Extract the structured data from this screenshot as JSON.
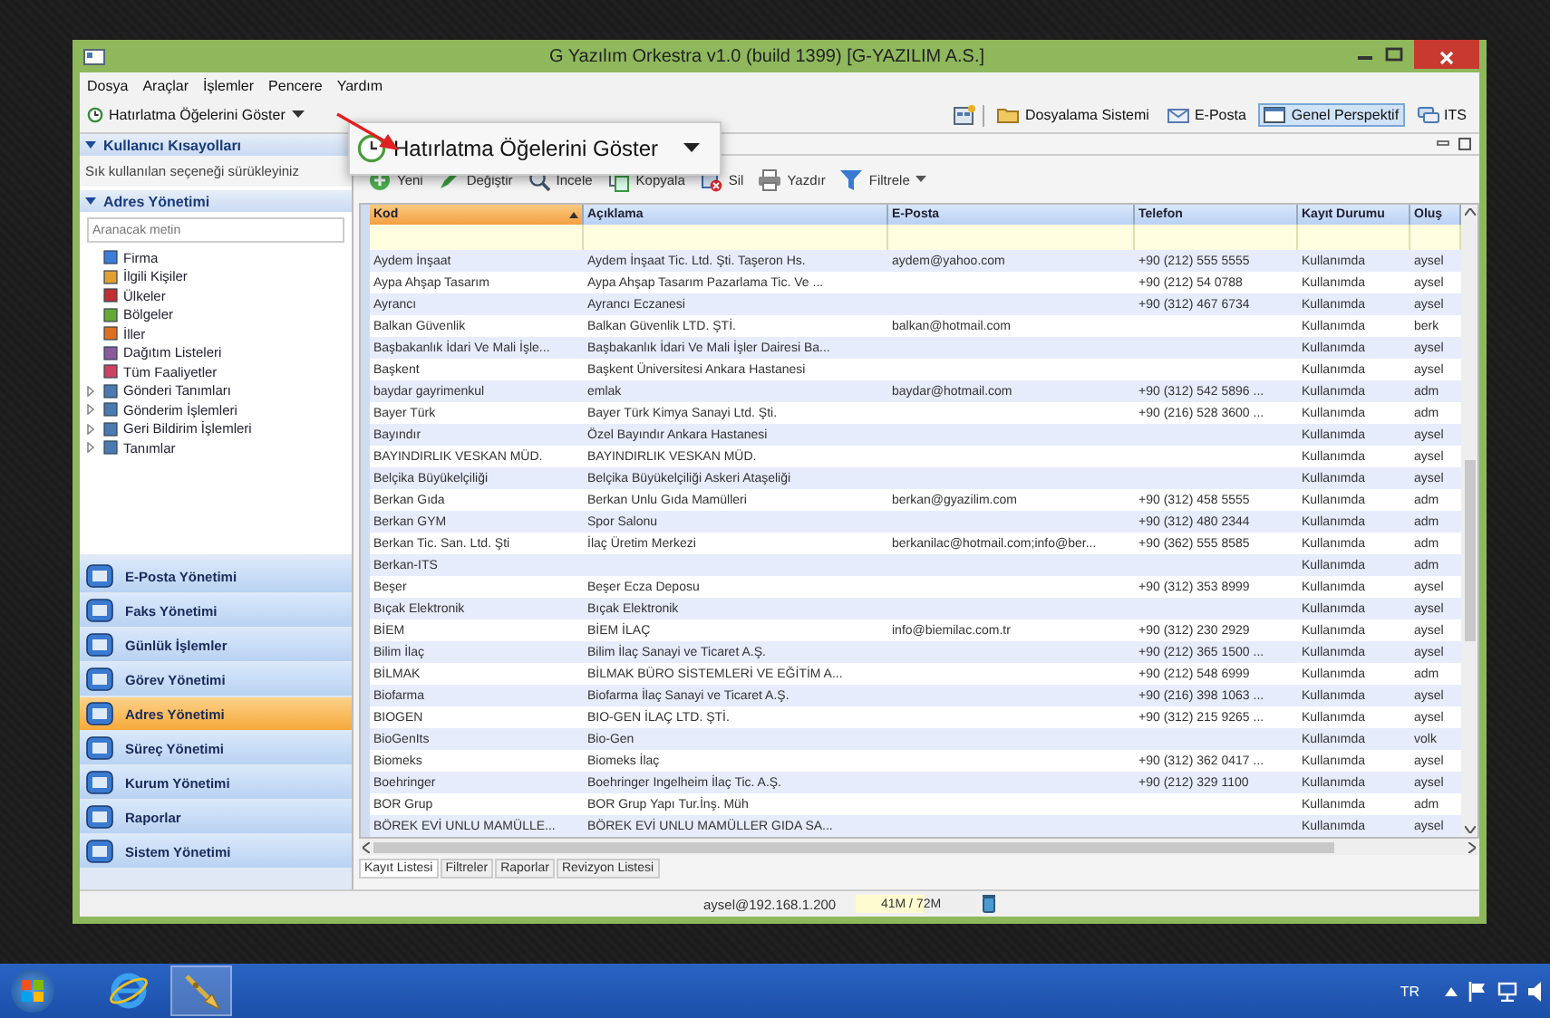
{
  "window": {
    "title": "G Yazılım Orkestra v1.0 (build 1399) [G-YAZILIM A.S.]"
  },
  "menu": [
    "Dosya",
    "Araçlar",
    "İşlemler",
    "Pencere",
    "Yardım"
  ],
  "reminder_button": {
    "label": "Hatırlatma Öğelerini Göster"
  },
  "callout": {
    "label": "Hatırlatma Öğelerini Göster"
  },
  "perspectives": [
    {
      "label": "Dosyalama Sistemi",
      "kind": "folder",
      "selected": false
    },
    {
      "label": "E-Posta",
      "kind": "mail",
      "selected": false
    },
    {
      "label": "Genel Perspektif",
      "kind": "window",
      "selected": true
    },
    {
      "label": "ITS",
      "kind": "chat",
      "selected": false
    }
  ],
  "sidebar": {
    "shortcuts_title": "Kullanıcı Kısayolları",
    "shortcuts_hint": "Sık kullanılan seçeneği sürükleyiniz",
    "section_title": "Adres Yönetimi",
    "search_placeholder": "Aranacak metin",
    "tree": [
      {
        "label": "Firma",
        "kind": "leaf"
      },
      {
        "label": "İlgili Kişiler",
        "kind": "leaf"
      },
      {
        "label": "Ülkeler",
        "kind": "leaf"
      },
      {
        "label": "Bölgeler",
        "kind": "leaf"
      },
      {
        "label": "İller",
        "kind": "leaf"
      },
      {
        "label": "Dağıtım Listeleri",
        "kind": "leaf"
      },
      {
        "label": "Tüm Faaliyetler",
        "kind": "leaf"
      },
      {
        "label": "Gönderi Tanımları",
        "kind": "folder"
      },
      {
        "label": "Gönderim İşlemleri",
        "kind": "folder"
      },
      {
        "label": "Geri Bildirim İşlemleri",
        "kind": "folder"
      },
      {
        "label": "Tanımlar",
        "kind": "folder"
      }
    ],
    "nav": [
      {
        "label": "E-Posta Yönetimi",
        "selected": false
      },
      {
        "label": "Faks Yönetimi",
        "selected": false
      },
      {
        "label": "Günlük İşlemler",
        "selected": false
      },
      {
        "label": "Görev Yönetimi",
        "selected": false
      },
      {
        "label": "Adres Yönetimi",
        "selected": true
      },
      {
        "label": "Süreç Yönetimi",
        "selected": false
      },
      {
        "label": "Kurum Yönetimi",
        "selected": false
      },
      {
        "label": "Raporlar",
        "selected": false
      },
      {
        "label": "Sistem Yönetimi",
        "selected": false
      }
    ]
  },
  "actions": [
    {
      "label": "Yeni",
      "kind": "new",
      "dropdown": false
    },
    {
      "label": "Değiştir",
      "kind": "edit",
      "dropdown": false
    },
    {
      "label": "İncele",
      "kind": "view",
      "dropdown": false
    },
    {
      "label": "Kopyala",
      "kind": "copy",
      "dropdown": false
    },
    {
      "label": "Sil",
      "kind": "delete",
      "dropdown": false
    },
    {
      "label": "Yazdır",
      "kind": "print",
      "dropdown": false
    },
    {
      "label": "Filtrele",
      "kind": "filter",
      "dropdown": true
    }
  ],
  "table": {
    "columns": [
      {
        "label": "Kod",
        "sorted": true
      },
      {
        "label": "Açıklama",
        "sorted": false
      },
      {
        "label": "E-Posta",
        "sorted": false
      },
      {
        "label": "Telefon",
        "sorted": false
      },
      {
        "label": "Kayıt Durumu",
        "sorted": false
      },
      {
        "label": "Oluş",
        "sorted": false
      }
    ],
    "rows": [
      [
        "Aydem İnşaat",
        "Aydem İnşaat Tic. Ltd. Şti. Taşeron Hs.",
        "aydem@yahoo.com",
        "+90 (212) 555 5555",
        "Kullanımda",
        "aysel"
      ],
      [
        "Aypa Ahşap Tasarım",
        "Aypa Ahşap Tasarım Pazarlama Tic. Ve ...",
        "",
        "+90 (212) 54 0788",
        "Kullanımda",
        "aysel"
      ],
      [
        "Ayrancı",
        "Ayrancı Eczanesi",
        "",
        "+90 (312) 467 6734",
        "Kullanımda",
        "aysel"
      ],
      [
        "Balkan Güvenlik",
        "Balkan Güvenlik LTD. ŞTİ.",
        "balkan@hotmail.com",
        "",
        "Kullanımda",
        "berk"
      ],
      [
        "Başbakanlık İdari Ve Mali İşle...",
        "Başbakanlık İdari Ve Mali İşler Dairesi Ba...",
        "",
        "",
        "Kullanımda",
        "aysel"
      ],
      [
        "Başkent",
        "Başkent Üniversitesi Ankara Hastanesi",
        "",
        "",
        "Kullanımda",
        "aysel"
      ],
      [
        "baydar gayrimenkul",
        "emlak",
        "baydar@hotmail.com",
        "+90 (312) 542 5896 ...",
        "Kullanımda",
        "adm"
      ],
      [
        "Bayer Türk",
        "Bayer Türk Kimya Sanayi Ltd. Şti.",
        "",
        "+90 (216) 528 3600 ...",
        "Kullanımda",
        "adm"
      ],
      [
        "Bayındır",
        "Özel Bayındır Ankara Hastanesi",
        "",
        "",
        "Kullanımda",
        "aysel"
      ],
      [
        "BAYINDIRLIK VESKAN MÜD.",
        "BAYINDIRLIK VESKAN MÜD.",
        "",
        "",
        "Kullanımda",
        "aysel"
      ],
      [
        "Belçika Büyükelçiliği",
        "Belçika Büyükelçiliği Askeri Ataşeliği",
        "",
        "",
        "Kullanımda",
        "aysel"
      ],
      [
        "Berkan Gıda",
        "Berkan Unlu Gıda Mamülleri",
        "berkan@gyazilim.com",
        "+90 (312) 458 5555",
        "Kullanımda",
        "adm"
      ],
      [
        "Berkan GYM",
        "Spor Salonu",
        "",
        "+90 (312) 480 2344",
        "Kullanımda",
        "adm"
      ],
      [
        "Berkan Tic. San. Ltd. Şti",
        "İlaç Üretim Merkezi",
        "berkanilac@hotmail.com;info@ber...",
        "+90 (362) 555 8585",
        "Kullanımda",
        "adm"
      ],
      [
        "Berkan-ITS",
        "",
        "",
        "",
        "Kullanımda",
        "adm"
      ],
      [
        "Beşer",
        "Beşer Ecza Deposu",
        "",
        "+90 (312) 353 8999",
        "Kullanımda",
        "aysel"
      ],
      [
        "Bıçak Elektronik",
        "Bıçak Elektronik",
        "",
        "",
        "Kullanımda",
        "aysel"
      ],
      [
        "BİEM",
        "BİEM İLAÇ",
        "info@biemilac.com.tr",
        "+90 (312) 230 2929",
        "Kullanımda",
        "aysel"
      ],
      [
        "Bilim İlaç",
        "Bilim İlaç Sanayi ve Ticaret A.Ş.",
        "",
        "+90 (212) 365 1500 ...",
        "Kullanımda",
        "aysel"
      ],
      [
        "BİLMAK",
        "BİLMAK BÜRO SİSTEMLERİ VE EĞİTİM A...",
        "",
        "+90 (212) 548 6999",
        "Kullanımda",
        "adm"
      ],
      [
        "Biofarma",
        "Biofarma İlaç Sanayi ve Ticaret A.Ş.",
        "",
        "+90 (216) 398 1063 ...",
        "Kullanımda",
        "aysel"
      ],
      [
        "BIOGEN",
        "BIO-GEN İLAÇ LTD. ŞTİ.",
        "",
        "+90 (312) 215 9265 ...",
        "Kullanımda",
        "aysel"
      ],
      [
        "BioGenIts",
        "Bio-Gen",
        "",
        "",
        "Kullanımda",
        "volk"
      ],
      [
        "Biomeks",
        "Biomeks İlaç",
        "",
        "+90 (312) 362 0417 ...",
        "Kullanımda",
        "aysel"
      ],
      [
        "Boehringer",
        "Boehringer Ingelheim İlaç Tic. A.Ş.",
        "",
        "+90 (212) 329 1100",
        "Kullanımda",
        "aysel"
      ],
      [
        "BOR Grup",
        "BOR Grup Yapı Tur.İnş. Müh",
        "",
        "",
        "Kullanımda",
        "adm"
      ],
      [
        "BÖREK EVİ UNLU MAMÜLLE...",
        "BÖREK EVİ UNLU MAMÜLLER GIDA SA...",
        "",
        "",
        "Kullanımda",
        "aysel"
      ]
    ]
  },
  "bottom_tabs": [
    {
      "label": "Kayıt Listesi",
      "selected": true
    },
    {
      "label": "Filtreler",
      "selected": false
    },
    {
      "label": "Raporlar",
      "selected": false
    },
    {
      "label": "Revizyon Listesi",
      "selected": false
    }
  ],
  "status_bar": {
    "user": "aysel@192.168.1.200",
    "memory": "41M / 72M",
    "level": 0.57
  },
  "taskbar": {
    "language": "TR",
    "apps": [
      {
        "kind": "browser",
        "selected": false
      },
      {
        "kind": "trumpet",
        "selected": true
      }
    ]
  }
}
